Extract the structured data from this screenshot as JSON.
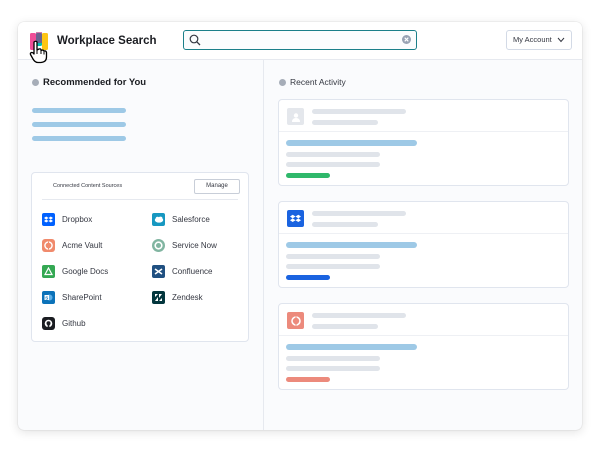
{
  "header": {
    "app_title": "Workplace Search",
    "search_value": "",
    "account_label": "My Account"
  },
  "recommended": {
    "heading": "Recommended for You"
  },
  "sources": {
    "title": "Connected Content Sources",
    "manage_label": "Manage",
    "items": [
      {
        "label": "Dropbox",
        "icon": "dropbox-icon",
        "color": "#0061ff"
      },
      {
        "label": "Salesforce",
        "icon": "salesforce-icon",
        "color": "#1798c1"
      },
      {
        "label": "Acme Vault",
        "icon": "acme-vault-icon",
        "color": "#f08a6c"
      },
      {
        "label": "Service Now",
        "icon": "servicenow-icon",
        "color": "#81b5a1"
      },
      {
        "label": "Google Docs",
        "icon": "google-docs-icon",
        "color": "#34a853"
      },
      {
        "label": "Confluence",
        "icon": "confluence-icon",
        "color": "#205081"
      },
      {
        "label": "SharePoint",
        "icon": "sharepoint-icon",
        "color": "#0b72b9"
      },
      {
        "label": "Zendesk",
        "icon": "zendesk-icon",
        "color": "#03363d"
      },
      {
        "label": "Github",
        "icon": "github-icon",
        "color": "#1a1c21"
      }
    ]
  },
  "activity": {
    "heading": "Recent Activity",
    "cards": [
      {
        "icon": "user-avatar-icon",
        "accent": "#2fb86b"
      },
      {
        "icon": "dropbox-icon",
        "accent": "#1a63e0"
      },
      {
        "icon": "acme-vault-icon",
        "accent": "#ec8a7c"
      }
    ]
  }
}
